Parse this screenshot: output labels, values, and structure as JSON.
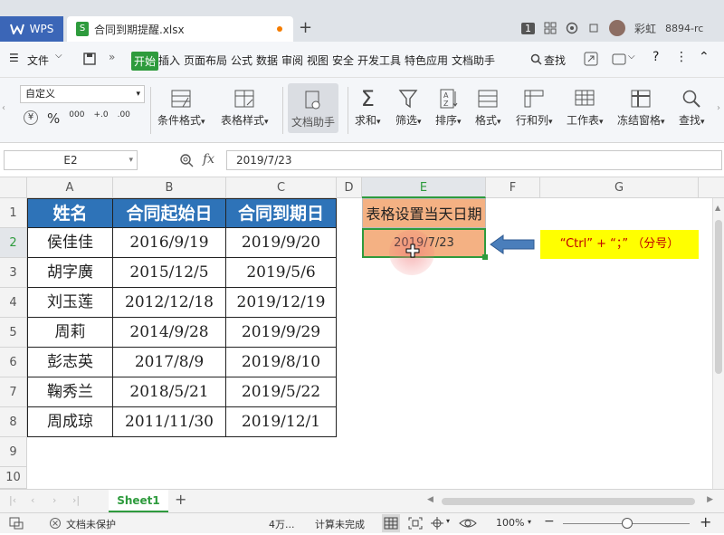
{
  "titlebar": {
    "app_tab": "WPS",
    "file_tab": "合同到期提醒.xlsx",
    "new_tab": "+",
    "badge": "1",
    "user_name": "彩虹",
    "user_id": "8894-rc"
  },
  "menu": {
    "file_label": "文件",
    "items": [
      "开始",
      "插入",
      "页面布局",
      "公式",
      "数据",
      "审阅",
      "视图",
      "安全",
      "开发工具",
      "特色应用",
      "文档助手"
    ],
    "search_label": "查找",
    "help_label": "?"
  },
  "ribbon": {
    "number_format": "自定义",
    "buttons": [
      "条件格式",
      "表格样式",
      "文档助手",
      "求和",
      "筛选",
      "排序",
      "格式",
      "行和列",
      "工作表",
      "冻结窗格",
      "查找"
    ],
    "format_btns": [
      "¥",
      "%",
      "000",
      "+.0",
      ".00"
    ]
  },
  "formula_bar": {
    "name_box": "E2",
    "fx": "fx",
    "value": "2019/7/23"
  },
  "grid": {
    "columns": [
      "A",
      "B",
      "C",
      "D",
      "E",
      "F",
      "G"
    ],
    "rows": [
      "1",
      "2",
      "3",
      "4",
      "5",
      "6",
      "7",
      "8",
      "9",
      "10"
    ],
    "headers": [
      "姓名",
      "合同起始日",
      "合同到期日"
    ],
    "data": [
      [
        "侯佳佳",
        "2016/9/19",
        "2019/9/20"
      ],
      [
        "胡字廣",
        "2015/12/5",
        "2019/5/6"
      ],
      [
        "刘玉莲",
        "2012/12/18",
        "2019/12/19"
      ],
      [
        "周莉",
        "2014/9/28",
        "2019/9/29"
      ],
      [
        "彭志英",
        "2017/8/9",
        "2019/8/10"
      ],
      [
        "鞠秀兰",
        "2018/5/21",
        "2019/5/22"
      ],
      [
        "周成琼",
        "2011/11/30",
        "2019/12/1"
      ]
    ],
    "e1": "表格设置当天日期",
    "e2": "2019/7/23",
    "annotation": "“Ctrl” + “；” （分号）"
  },
  "sheetbar": {
    "sheet_name": "Sheet1",
    "add": "+"
  },
  "status": {
    "protect": "文档未保护",
    "count": "4万...",
    "calc": "计算未完成",
    "zoom": "100%",
    "minus": "−",
    "plus": "+"
  },
  "colors": {
    "header_blue": "#2e73b8",
    "e_cell": "#f4b183",
    "annotation_bg": "#ffff00",
    "annotation_text": "#c00000",
    "accent_green": "#2e9b3d",
    "arrow_blue": "#4a7ebb"
  }
}
